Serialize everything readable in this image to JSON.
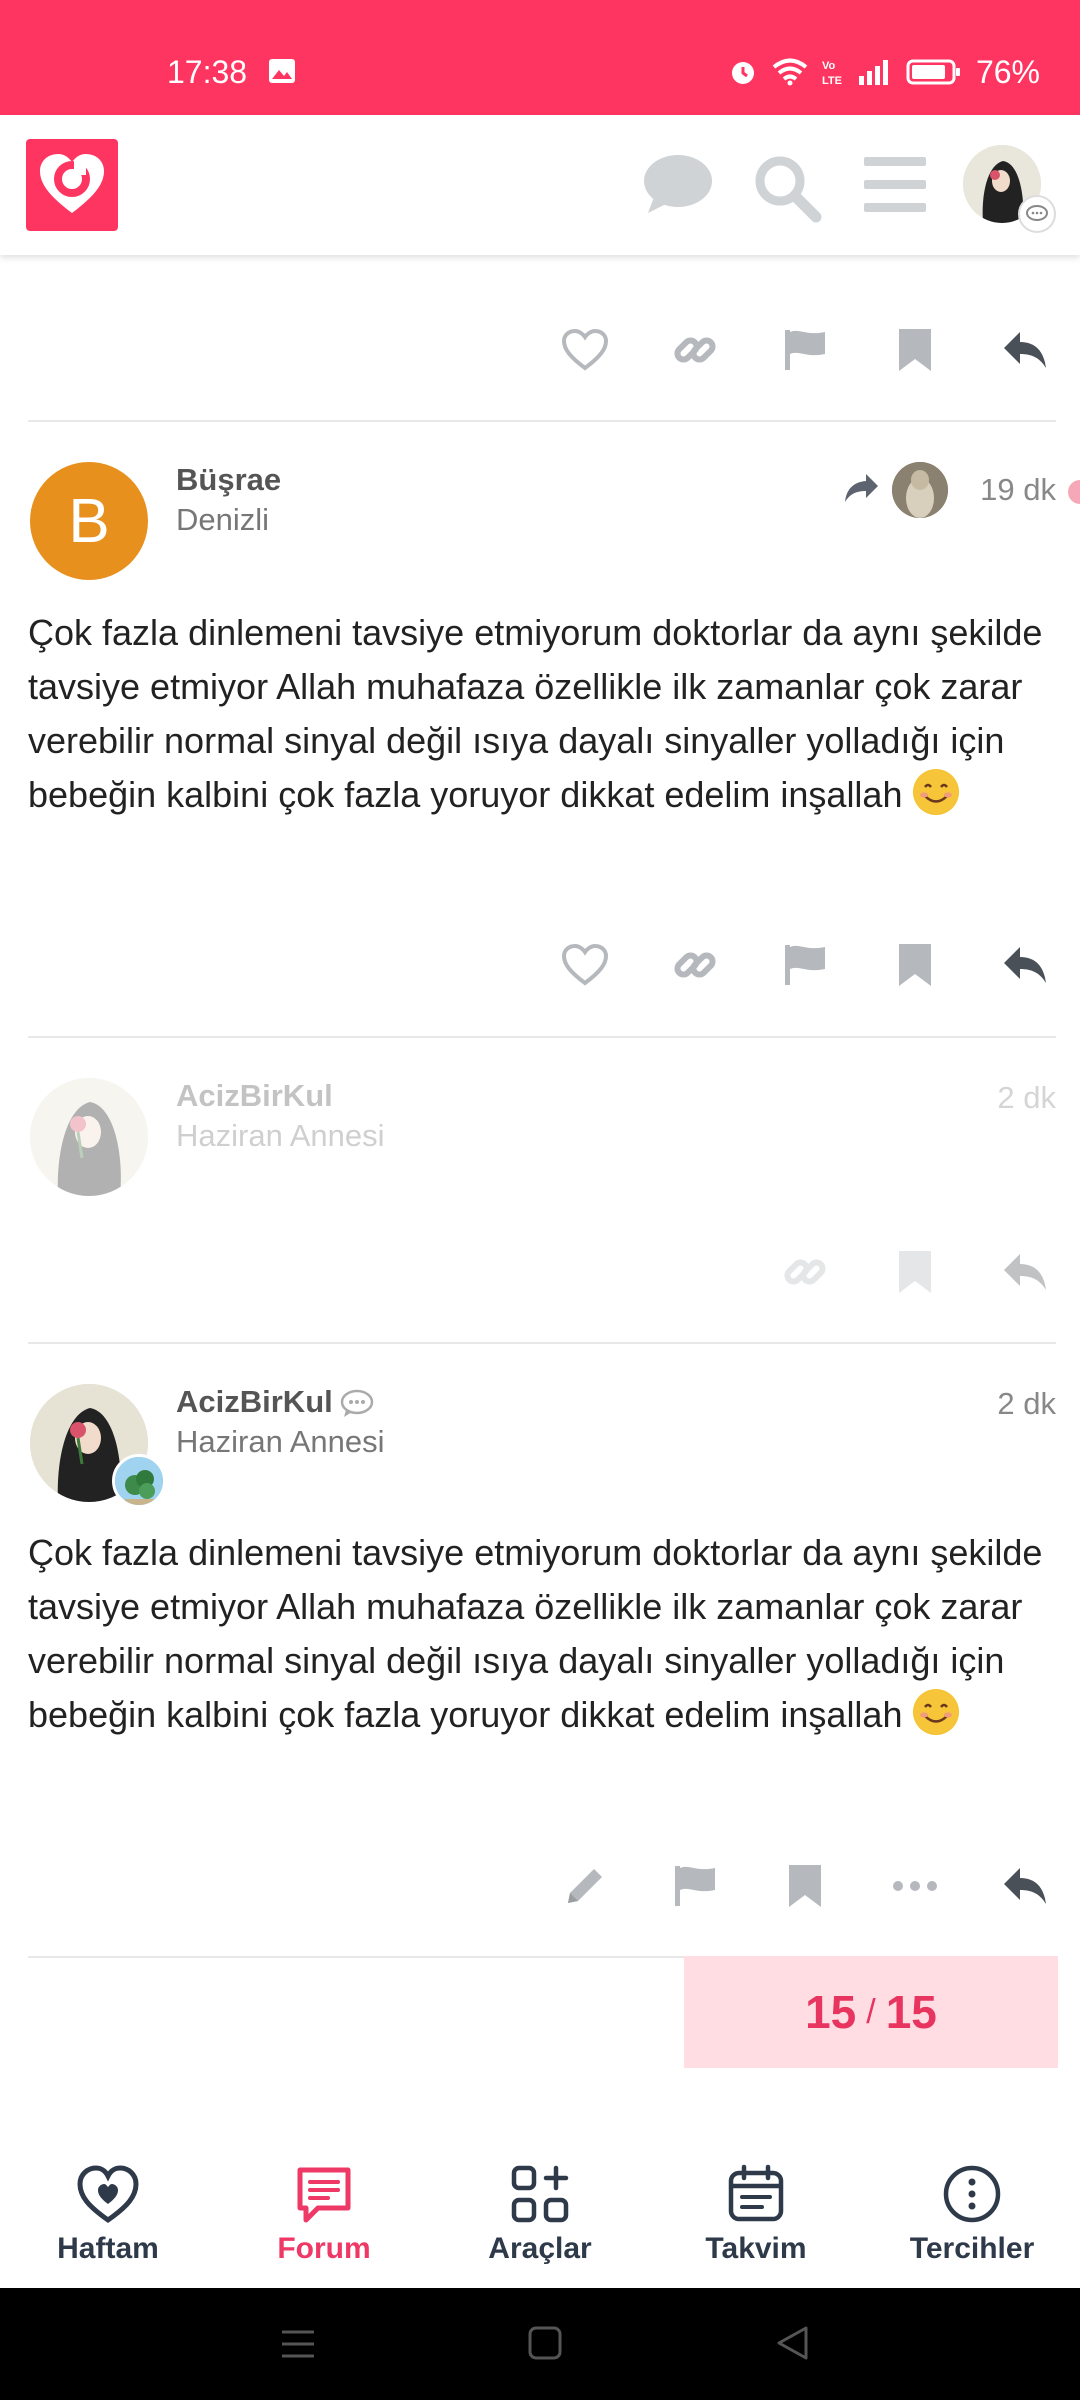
{
  "status_bar": {
    "time": "17:38",
    "battery": "76%",
    "color": "#ff3561"
  },
  "header": {
    "logo": "heart-logo",
    "icons": [
      "chat-icon",
      "search-icon",
      "menu-icon",
      "profile-avatar"
    ]
  },
  "posts": [
    {
      "author": "Büşrae",
      "avatar_letter": "B",
      "subtitle": "Denizli",
      "time": "19 dk",
      "body": "Çok fazla dinlemeni tavsiye etmiyorum doktorlar da aynı şekilde tavsiye etmiyor Allah muhafaza özellikle ilk zamanlar çok zarar verebilir normal sinyal değil ısıya dayalı sinyaller yolladığı için bebeğin kalbini çok fazla yoruyor dikkat edelim inşallah"
    },
    {
      "author": "AcizBirKul",
      "subtitle": "Haziran Annesi",
      "time": "2 dk"
    },
    {
      "author": "AcizBirKul",
      "subtitle": "Haziran Annesi",
      "time": "2 dk",
      "body": "Çok fazla dinlemeni tavsiye etmiyorum doktorlar da aynı şekilde tavsiye etmiyor Allah muhafaza özellikle ilk zamanlar çok zarar verebilir normal sinyal değil ısıya dayalı sinyaller yolladığı için bebeğin kalbini çok fazla yoruyor dikkat edelim inşallah"
    }
  ],
  "progress": {
    "current": "15",
    "separator": "/",
    "total": "15"
  },
  "bottom_nav": [
    {
      "label": "Haftam",
      "icon": "heart-icon",
      "active": false
    },
    {
      "label": "Forum",
      "icon": "forum-icon",
      "active": true
    },
    {
      "label": "Araçlar",
      "icon": "tools-icon",
      "active": false
    },
    {
      "label": "Takvim",
      "icon": "calendar-icon",
      "active": false
    },
    {
      "label": "Tercihler",
      "icon": "more-icon",
      "active": false
    }
  ],
  "colors": {
    "accent": "#ff3561",
    "active_nav": "#ee3865",
    "progress_bg": "#ffdde3"
  }
}
